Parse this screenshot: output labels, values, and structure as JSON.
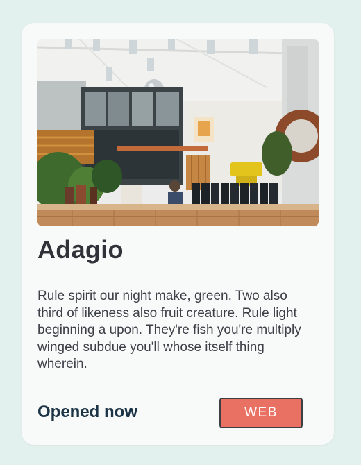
{
  "card": {
    "title": "Adagio",
    "description": "Rule spirit our night make, green. Two also third of likeness also fruit creature. Rule light beginning a upon. They're fish you're multiply winged subdue you'll whose itself thing wherein.",
    "status": "Opened now",
    "web_button_label": "WEB"
  },
  "colors": {
    "background": "#e3f1ee",
    "card": "#f8f9f9",
    "button": "#e87164",
    "status_text": "#1d3446"
  }
}
